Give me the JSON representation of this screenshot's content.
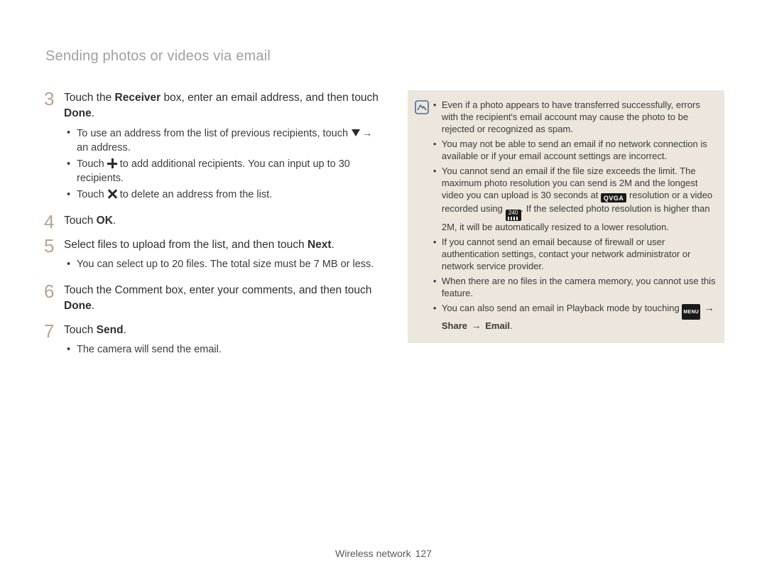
{
  "header": {
    "title": "Sending photos or videos via email"
  },
  "footer": {
    "section": "Wireless network",
    "page": "127"
  },
  "steps": {
    "s3": {
      "num": "3",
      "lead_a": "Touch the ",
      "lead_b": "Receiver",
      "lead_c": " box, enter an email address, and then touch ",
      "lead_d": "Done",
      "lead_e": ".",
      "b1a": "To use an address from the list of previous recipients, touch ",
      "b1b": " an address.",
      "b2a": "Touch ",
      "b2b": " to add additional recipients. You can input up to 30 recipients.",
      "b3a": "Touch ",
      "b3b": " to delete an address from the list."
    },
    "s4": {
      "num": "4",
      "lead_a": "Touch ",
      "lead_b": "OK",
      "lead_c": "."
    },
    "s5": {
      "num": "5",
      "lead_a": "Select files to upload from the list, and then touch ",
      "lead_b": "Next",
      "lead_c": ".",
      "b1": "You can select up to 20 files. The total size must be 7 MB or less."
    },
    "s6": {
      "num": "6",
      "lead_a": "Touch the Comment box, enter your comments, and then touch ",
      "lead_b": "Done",
      "lead_c": "."
    },
    "s7": {
      "num": "7",
      "lead_a": "Touch ",
      "lead_b": "Send",
      "lead_c": ".",
      "b1": "The camera will send the email."
    }
  },
  "note": {
    "i1": "Even if a photo appears to have transferred successfully, errors with the recipient's email account may cause the photo to be rejected or recognized as spam.",
    "i2": "You may not be able to send an email if no network connection is available or if your email account settings are incorrect.",
    "i3a": "You cannot send an email if the file size exceeds the limit. The maximum photo resolution you can send is 2M and the longest video you can upload is 30 seconds at ",
    "i3b": " resolution or a video recorded using ",
    "i3c": ". If the selected photo resolution is higher than 2M, it will be automatically resized to a lower resolution.",
    "i4": "If you cannot send an email because of firewall or user authentication settings, contact your network administrator or network service provider.",
    "i5": "When there are no files in the camera memory, you cannot use this feature.",
    "i6a": "You can also send an email in Playback mode by touching ",
    "i6b": "Share",
    "i6c": "Email",
    "qvga": "QVGA",
    "p240": "240",
    "menu": "MENU"
  }
}
